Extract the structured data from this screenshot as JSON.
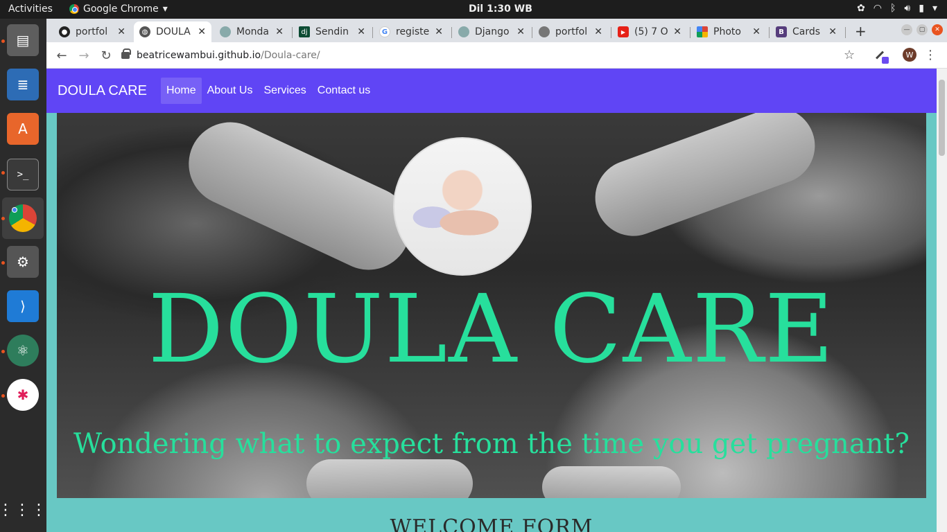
{
  "topbar": {
    "activities": "Activities",
    "app_name": "Google Chrome",
    "clock": "Dil  1:30 WB"
  },
  "tabs": [
    {
      "title": "portfol",
      "icon": "github-icon"
    },
    {
      "title": "DOULA",
      "icon": "globe-icon"
    },
    {
      "title": "Monda",
      "icon": "monday-icon"
    },
    {
      "title": "Sendin",
      "icon": "django-icon"
    },
    {
      "title": "registe",
      "icon": "google-icon"
    },
    {
      "title": "Django",
      "icon": "django-icon"
    },
    {
      "title": "portfol",
      "icon": "github-icon"
    },
    {
      "title": "(5) 7 O",
      "icon": "youtube-icon"
    },
    {
      "title": "Photo",
      "icon": "photos-icon"
    },
    {
      "title": "Cards",
      "icon": "bootstrap-icon"
    }
  ],
  "address_bar": {
    "host": "beatricewambui.github.io",
    "path": "/Doula-care/"
  },
  "profile_initial": "W",
  "site": {
    "brand": "DOULA CARE",
    "nav": [
      "Home",
      "About Us",
      "Services",
      "Contact us"
    ],
    "active_nav": "Home",
    "hero_title": "DOULA CARE",
    "hero_subtitle": "Wondering what to expect from the time you get pregnant?",
    "welcome_heading": "WELCOME FORM"
  },
  "colors": {
    "navbar": "#6045f5",
    "accent_green": "#27df9c",
    "page_bg": "#68c8c4"
  }
}
